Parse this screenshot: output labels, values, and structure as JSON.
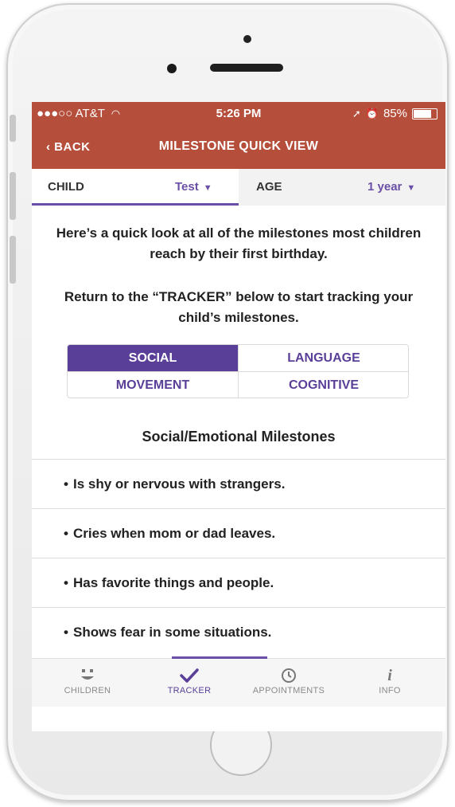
{
  "status": {
    "carrier": "●●●○○ AT&T",
    "time": "5:26 PM",
    "battery": "85%",
    "battery_level": 0.85
  },
  "nav": {
    "back_label": "‹ BACK",
    "title": "MILESTONE QUICK VIEW"
  },
  "selector": {
    "child_label": "CHILD",
    "child_value": "Test",
    "age_label": "AGE",
    "age_value": "1 year"
  },
  "intro": {
    "line1": "Here’s a quick look at all of the milestones most children reach by their first birthday.",
    "line2": "Return to the “TRACKER” below to start tracking your child’s milestones."
  },
  "categories": {
    "social": "SOCIAL",
    "language": "LANGUAGE",
    "movement": "MOVEMENT",
    "cognitive": "COGNITIVE",
    "active": "social"
  },
  "section_title": "Social/Emotional Milestones",
  "milestones": [
    "Is shy or nervous with strangers.",
    "Cries when mom or dad leaves.",
    "Has favorite things and people.",
    "Shows fear in some situations."
  ],
  "tabs": {
    "children": "CHILDREN",
    "tracker": "TRACKER",
    "appointments": "APPOINTMENTS",
    "info": "INFO",
    "active": "tracker"
  },
  "colors": {
    "header": "#b54f3c",
    "accent": "#5a3f98"
  },
  "icons": {
    "children": "face-icon",
    "tracker": "checkmark-icon",
    "appointments": "clock-icon",
    "info": "info-icon"
  }
}
